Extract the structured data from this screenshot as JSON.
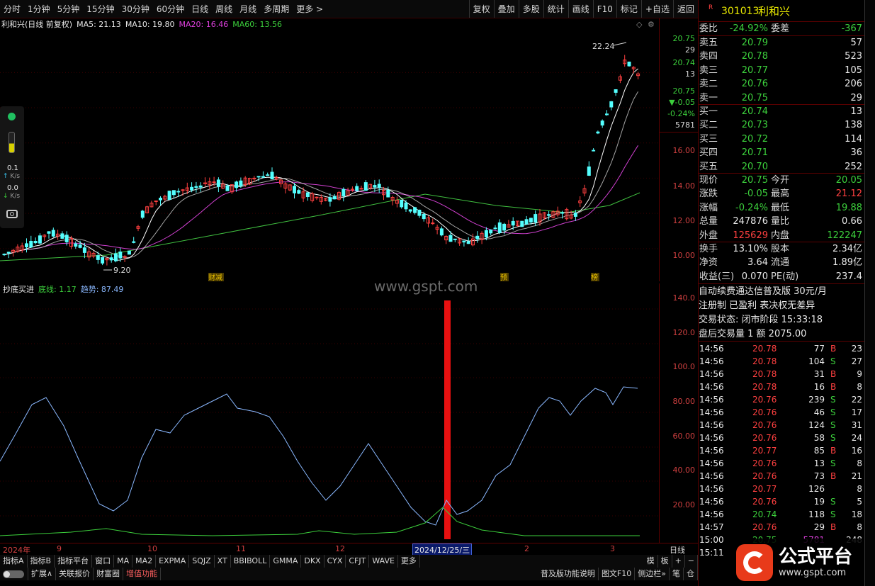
{
  "toolbar": {
    "periods": [
      "分时",
      "1分钟",
      "5分钟",
      "15分钟",
      "30分钟",
      "60分钟",
      "日线",
      "周线",
      "月线",
      "多周期",
      "更多 >"
    ],
    "right_buttons": [
      "复权",
      "叠加",
      "多股",
      "统计",
      "画线",
      "F10",
      "标记",
      "+自选",
      "返回"
    ]
  },
  "chart_header": {
    "name": "利和兴(日线 前复权)",
    "ma5": "MA5: 21.13",
    "ma10": "MA10: 19.80",
    "ma20": "MA20: 16.46",
    "ma60": "MA60: 13.56"
  },
  "price_annotations": {
    "high": "22.24",
    "low": "9.20"
  },
  "event_markers": [
    "财",
    "减",
    "预",
    "榜"
  ],
  "indicator_header": {
    "name": "抄底买进",
    "bottom": "底线: 1.17",
    "trend": "趋势: 87.49"
  },
  "watermark": "www.gspt.com",
  "y_axis_main": {
    "top_labels": [
      "20.75",
      "29",
      "20.74",
      "13",
      "20.75",
      "▼-0.05",
      "-0.24%",
      "5781"
    ],
    "ticks": [
      "16.00",
      "14.00",
      "12.00",
      "10.00"
    ]
  },
  "y_axis_ind": {
    "ticks": [
      "140.0",
      "120.0",
      "100.0",
      "80.00",
      "60.00",
      "40.00",
      "20.00"
    ]
  },
  "x_axis": {
    "labels": [
      "2024年",
      "9",
      "10",
      "11",
      "12",
      "2024/12/25/三",
      "2",
      "3"
    ],
    "right_label": "日线"
  },
  "tabs_row1": [
    "指标A",
    "指标B",
    "指标平台",
    "窗口",
    "MA",
    "MA2",
    "EXPMA",
    "SQJZ",
    "XT",
    "BBIBOLL",
    "GMMA",
    "DKX",
    "CYX",
    "CFJT",
    "WAVE",
    "更多"
  ],
  "tabs_row1_right": [
    "模",
    "板",
    "+",
    "−"
  ],
  "tabs_row2": [
    "扩展∧",
    "关联报价",
    "财富圈",
    "增值功能"
  ],
  "tabs_row2_right": [
    "普及版功能说明",
    "图文F10",
    "侧边栏»",
    "笔",
    "仓"
  ],
  "left_widget": {
    "speed1": "0.1",
    "speed1_unit": "K/s",
    "speed2": "0.0",
    "speed2_unit": "K/s"
  },
  "quote": {
    "code": "301013",
    "name": "利和兴",
    "ratio_label": "委比",
    "ratio": "-24.92%",
    "diff_label": "委差",
    "diff": "-367",
    "asks": [
      {
        "label": "卖五",
        "price": "20.79",
        "vol": "57"
      },
      {
        "label": "卖四",
        "price": "20.78",
        "vol": "523"
      },
      {
        "label": "卖三",
        "price": "20.77",
        "vol": "105"
      },
      {
        "label": "卖二",
        "price": "20.76",
        "vol": "206"
      },
      {
        "label": "卖一",
        "price": "20.75",
        "vol": "29"
      }
    ],
    "bids": [
      {
        "label": "买一",
        "price": "20.74",
        "vol": "13"
      },
      {
        "label": "买二",
        "price": "20.73",
        "vol": "138"
      },
      {
        "label": "买三",
        "price": "20.72",
        "vol": "114"
      },
      {
        "label": "买四",
        "price": "20.71",
        "vol": "36"
      },
      {
        "label": "买五",
        "price": "20.70",
        "vol": "252"
      }
    ],
    "stats": [
      {
        "l1": "现价",
        "v1": "20.75",
        "l2": "今开",
        "v2": "20.05"
      },
      {
        "l1": "涨跌",
        "v1": "-0.05",
        "l2": "最高",
        "v2": "21.12"
      },
      {
        "l1": "涨幅",
        "v1": "-0.24%",
        "l2": "最低",
        "v2": "19.88"
      },
      {
        "l1": "总量",
        "v1": "247876",
        "l2": "量比",
        "v2": "0.66"
      },
      {
        "l1": "外盘",
        "v1": "125629",
        "l2": "内盘",
        "v2": "122247"
      }
    ],
    "stats2": [
      {
        "l1": "换手",
        "v1": "13.10%",
        "l2": "股本",
        "v2": "2.34亿"
      },
      {
        "l1": "净资",
        "v1": "3.64",
        "l2": "流通",
        "v2": "1.89亿"
      },
      {
        "l1": "收益(三)",
        "v1": "0.070",
        "l2": "PE(动)",
        "v2": "237.4"
      }
    ],
    "info": [
      "自动续费通达信普及版  30元/月",
      "注册制 已盈利 表决权无差异",
      "交易状态: 闭市阶段 15:33:18",
      "盘后交易量 1 额 2075.00"
    ],
    "ticks": [
      {
        "t": "14:56",
        "p": "20.78",
        "v": "77",
        "d": "B",
        "n": "23"
      },
      {
        "t": "14:56",
        "p": "20.78",
        "v": "104",
        "d": "S",
        "n": "27"
      },
      {
        "t": "14:56",
        "p": "20.78",
        "v": "31",
        "d": "B",
        "n": "9"
      },
      {
        "t": "14:56",
        "p": "20.78",
        "v": "16",
        "d": "B",
        "n": "8"
      },
      {
        "t": "14:56",
        "p": "20.76",
        "v": "239",
        "d": "S",
        "n": "22"
      },
      {
        "t": "14:56",
        "p": "20.76",
        "v": "46",
        "d": "S",
        "n": "17"
      },
      {
        "t": "14:56",
        "p": "20.76",
        "v": "124",
        "d": "S",
        "n": "31"
      },
      {
        "t": "14:56",
        "p": "20.76",
        "v": "58",
        "d": "S",
        "n": "24"
      },
      {
        "t": "14:56",
        "p": "20.77",
        "v": "85",
        "d": "B",
        "n": "16"
      },
      {
        "t": "14:56",
        "p": "20.76",
        "v": "13",
        "d": "S",
        "n": "8"
      },
      {
        "t": "14:56",
        "p": "20.76",
        "v": "73",
        "d": "B",
        "n": "21"
      },
      {
        "t": "14:56",
        "p": "20.77",
        "v": "126",
        "d": "",
        "n": "8"
      },
      {
        "t": "14:56",
        "p": "20.76",
        "v": "19",
        "d": "S",
        "n": "5"
      },
      {
        "t": "14:56",
        "p": "20.74",
        "v": "118",
        "d": "S",
        "n": "18"
      },
      {
        "t": "14:57",
        "p": "20.76",
        "v": "29",
        "d": "B",
        "n": "8"
      },
      {
        "t": "15:00",
        "p": "20.75",
        "v": "5781",
        "d": "",
        "n": "248"
      },
      {
        "t": "15:11",
        "p": "",
        "v": "",
        "d": "",
        "n": ""
      }
    ]
  },
  "logo": {
    "text": "公式平台",
    "url": "www.gspt.com"
  },
  "colors": {
    "up": "#ff4040",
    "down": "#54ffff",
    "ma10": "#ffffff",
    "ma20": "#d040d0",
    "ma60": "#40c040",
    "signal": "#e81010"
  }
}
